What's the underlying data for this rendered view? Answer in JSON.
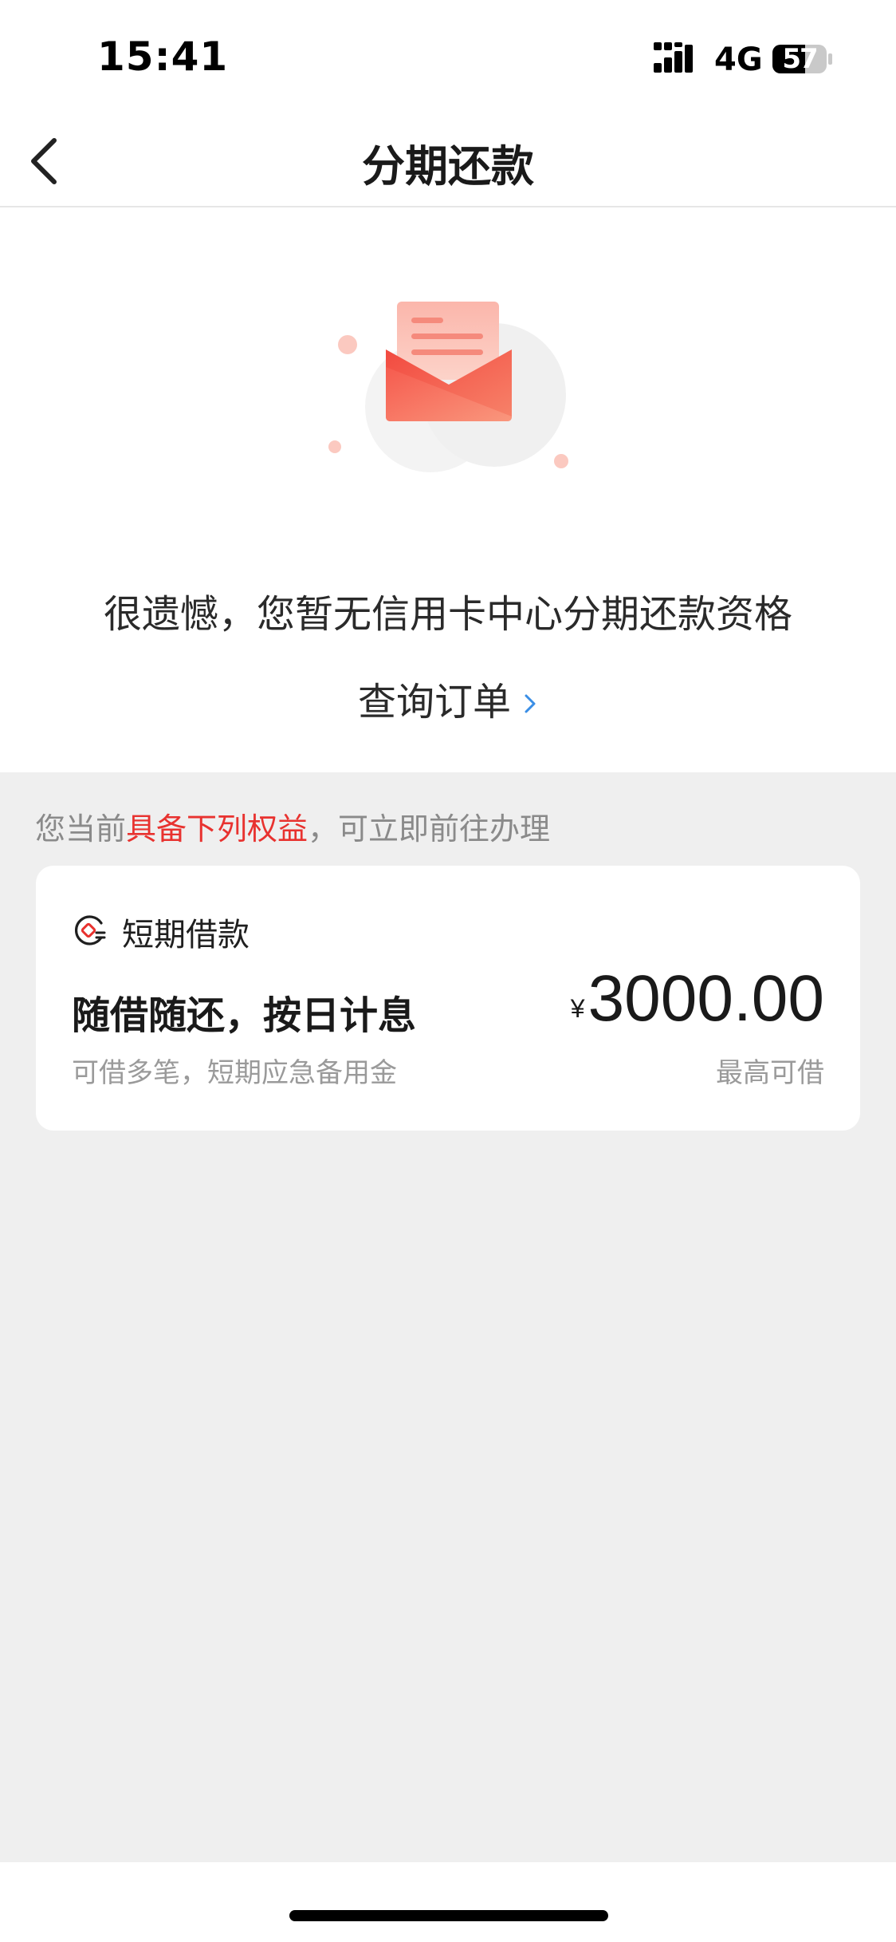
{
  "status_bar": {
    "time": "15:41",
    "network": "4G",
    "battery_level": "57",
    "icons": [
      "signal-icon",
      "battery-icon"
    ]
  },
  "nav": {
    "title": "分期还款",
    "back_icon": "chevron-left-icon"
  },
  "empty_state": {
    "illustration": "envelope-icon",
    "message": "很遗憾，您暂无信用卡中心分期还款资格",
    "query_link": "查询订单",
    "link_icon": "chevron-right-icon",
    "colors": {
      "envelope": "#f05a4f",
      "link_chevron": "#3a8ee6"
    }
  },
  "benefits": {
    "prefix": "您当前",
    "highlight": "具备下列权益",
    "suffix": "，可立即前往办理",
    "highlight_color": "#e8322f"
  },
  "loan_card": {
    "icon": "coin-icon",
    "product_name": "短期借款",
    "headline": "随借随还，按日计息",
    "subtext": "可借多笔，短期应急备用金",
    "currency": "¥",
    "amount": "3000.00",
    "amount_label": "最高可借"
  }
}
